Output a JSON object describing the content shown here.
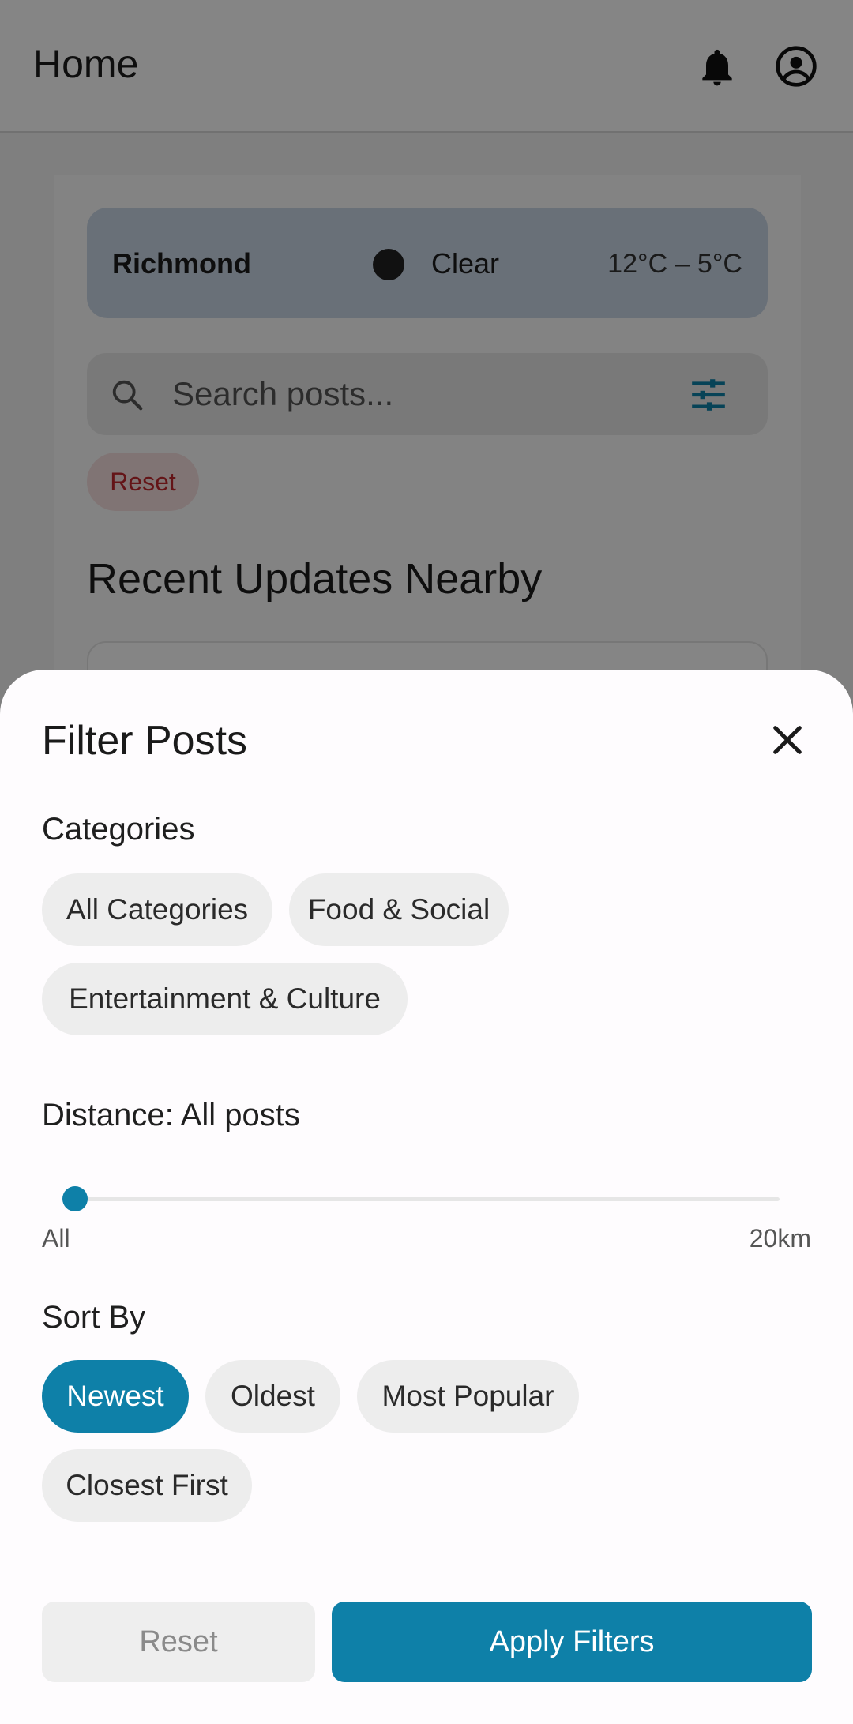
{
  "app_bar": {
    "title": "Home",
    "icons": [
      "bell-icon",
      "account-icon"
    ]
  },
  "weather": {
    "city": "Richmond",
    "condition": "Clear",
    "temperature": "12°C – 5°C"
  },
  "search": {
    "placeholder": "Search posts..."
  },
  "reset_chip": "Reset",
  "section_title": "Recent Updates Nearby",
  "filter_sheet": {
    "title": "Filter Posts",
    "categories_label": "Categories",
    "categories": [
      {
        "label": "All Categories",
        "selected": false
      },
      {
        "label": "Food & Social",
        "selected": false
      },
      {
        "label": "Entertainment & Culture",
        "selected": false
      }
    ],
    "distance_label": "Distance: All posts",
    "distance": {
      "value_fraction": 0,
      "min_label": "All",
      "max_label": "20km"
    },
    "sort_label": "Sort By",
    "sort_options": [
      {
        "label": "Newest",
        "selected": true
      },
      {
        "label": "Oldest",
        "selected": false
      },
      {
        "label": "Most Popular",
        "selected": false
      },
      {
        "label": "Closest First",
        "selected": false
      }
    ],
    "reset_button": "Reset",
    "apply_button": "Apply Filters"
  },
  "colors": {
    "accent": "#0e80a8",
    "weather_card": "#c9d6e6",
    "reset_chip_text": "#c0282d"
  }
}
